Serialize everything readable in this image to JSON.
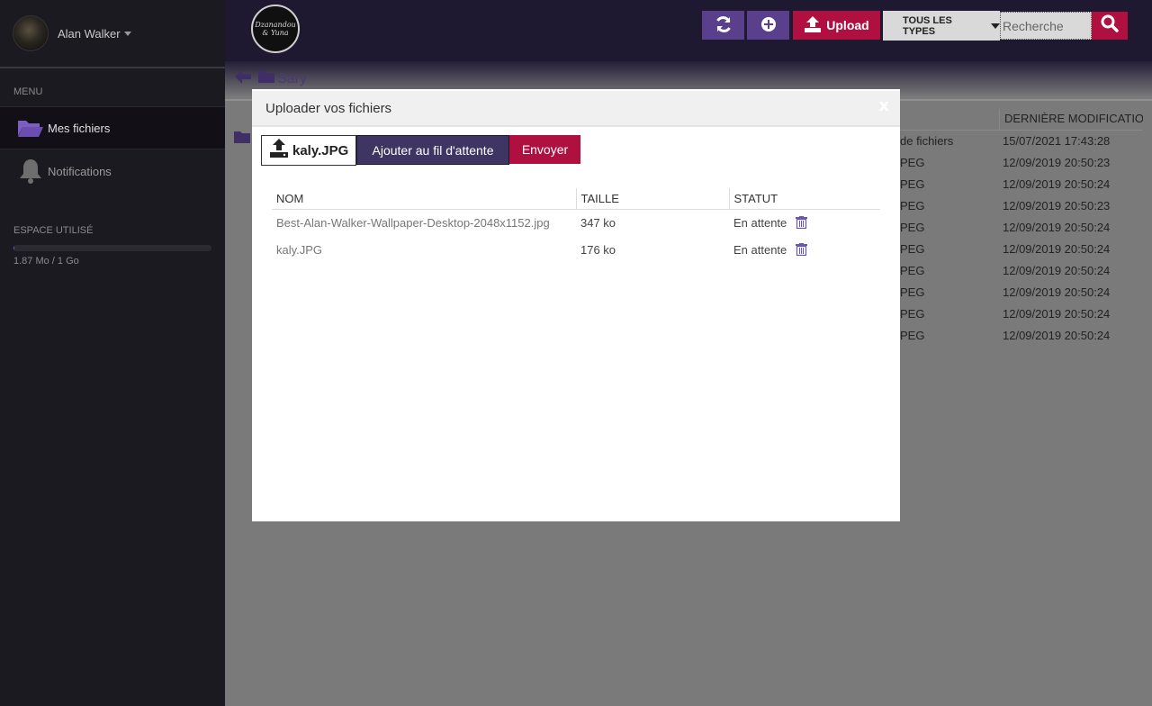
{
  "user": {
    "name": "Alan Walker"
  },
  "sidebar": {
    "menu_title": "MENU",
    "items": [
      {
        "label": "Mes fichiers",
        "icon": "folder-open-icon",
        "active": true
      },
      {
        "label": "Notifications",
        "icon": "bell-icon",
        "active": false
      }
    ],
    "storage": {
      "title": "ESPACE UTILISÉ",
      "text": "1.87 Mo / 1 Go",
      "used_fraction": 0.0018
    }
  },
  "topbar": {
    "logo_text": "Dzanandou & Yuna",
    "upload_label": "Upload",
    "type_filter": "TOUS LES TYPES",
    "search_placeholder": "Recherche"
  },
  "breadcrumb": {
    "folder": "Sary"
  },
  "background_table": {
    "header_modified": "DERNIÈRE MODIFICATION",
    "rows": [
      {
        "type": "de fichiers",
        "date": "15/07/2021 17:43:28"
      },
      {
        "type": "PEG",
        "date": "12/09/2019 20:50:23"
      },
      {
        "type": "PEG",
        "date": "12/09/2019 20:50:24"
      },
      {
        "type": "PEG",
        "date": "12/09/2019 20:50:23"
      },
      {
        "type": "PEG",
        "date": "12/09/2019 20:50:24"
      },
      {
        "type": "PEG",
        "date": "12/09/2019 20:50:24"
      },
      {
        "type": "PEG",
        "date": "12/09/2019 20:50:24"
      },
      {
        "type": "PEG",
        "date": "12/09/2019 20:50:24"
      },
      {
        "type": "PEG",
        "date": "12/09/2019 20:50:24"
      },
      {
        "type": "PEG",
        "date": "12/09/2019 20:50:24"
      }
    ]
  },
  "modal": {
    "title": "Uploader vos fichiers",
    "close": "x",
    "file_picker_label": "kaly.JPG",
    "queue_button": "Ajouter au fil d'attente",
    "send_button": "Envoyer",
    "columns": {
      "name": "NOM",
      "size": "TAILLE",
      "status": "STATUT"
    },
    "files": [
      {
        "name": "Best-Alan-Walker-Wallpaper-Desktop-2048x1152.jpg",
        "size": "347 ko",
        "status": "En attente"
      },
      {
        "name": "kaly.JPG",
        "size": "176 ko",
        "status": "En attente"
      }
    ]
  },
  "colors": {
    "primary": "#5a3f8c",
    "accent": "#b0103f",
    "sidebar": "#1c1a21"
  }
}
